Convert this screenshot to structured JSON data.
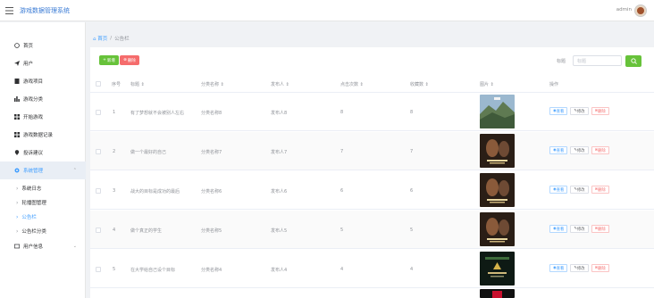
{
  "header": {
    "title": "游戏数据管理系统",
    "user": "admin"
  },
  "sidebar": {
    "items": [
      {
        "label": "首页",
        "icon": "home-icon"
      },
      {
        "label": "用户",
        "icon": "send-icon"
      },
      {
        "label": "游戏项目",
        "icon": "doc-icon"
      },
      {
        "label": "游戏分类",
        "icon": "chart-icon"
      },
      {
        "label": "开始游戏",
        "icon": "grid-icon"
      },
      {
        "label": "游戏数据记录",
        "icon": "grid-icon"
      },
      {
        "label": "投诉建议",
        "icon": "pin-icon"
      }
    ],
    "system": {
      "label": "系统管理",
      "icon": "gear-icon"
    },
    "sub_items": [
      {
        "label": "系统日志"
      },
      {
        "label": "轮播图管理"
      },
      {
        "label": "公告栏"
      },
      {
        "label": "公告栏分类"
      }
    ],
    "user_info": {
      "label": "用户信息",
      "icon": "card-icon"
    }
  },
  "breadcrumb": {
    "home": "首页",
    "separator": "/",
    "current": "公告栏"
  },
  "toolbar": {
    "add_label": "新增",
    "delete_label": "删除",
    "search_label": "标题",
    "search_placeholder": "标题"
  },
  "table": {
    "headers": [
      "序号",
      "标题",
      "分类名称",
      "发布人",
      "点击次数",
      "收藏数",
      "图片",
      "操作"
    ],
    "rows": [
      {
        "index": "1",
        "title": "有了梦想就不会被别人左右",
        "category": "分类名称8",
        "publisher": "发布人8",
        "clicks": "8",
        "favorites": "8",
        "image": "mountain-landscape"
      },
      {
        "index": "2",
        "title": "做一个最好的自己",
        "category": "分类名称7",
        "publisher": "发布人7",
        "clicks": "7",
        "favorites": "7",
        "image": "uncharted-cover"
      },
      {
        "index": "3",
        "title": "战大的目标是成功的最后",
        "category": "分类名称6",
        "publisher": "发布人6",
        "clicks": "6",
        "favorites": "6",
        "image": "uncharted-cover"
      },
      {
        "index": "4",
        "title": "做个真正的学生",
        "category": "分类名称5",
        "publisher": "发布人5",
        "clicks": "5",
        "favorites": "5",
        "image": "uncharted-cover"
      },
      {
        "index": "5",
        "title": "在大学给自己设个目标",
        "category": "分类名称4",
        "publisher": "发布人4",
        "clicks": "4",
        "favorites": "4",
        "image": "zelda-cover"
      }
    ],
    "ops": {
      "view": "查看",
      "edit": "修改",
      "delete": "删除"
    }
  },
  "colors": {
    "accent": "#409eff",
    "success": "#67c23a",
    "danger": "#f56c6c"
  }
}
